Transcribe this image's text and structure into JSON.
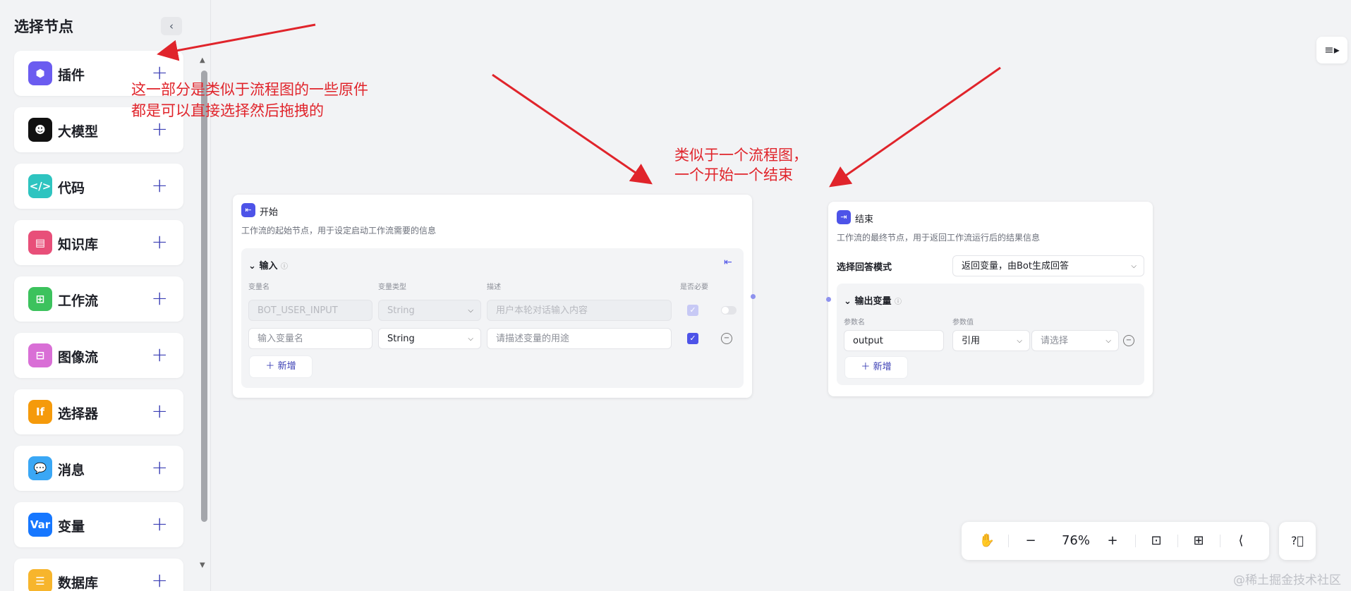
{
  "sidebar": {
    "title": "选择节点",
    "collapse_icon": "‹",
    "items": [
      {
        "label": "插件",
        "icon": "cube-icon",
        "icon_text": "⬢",
        "color": "#6b5cf0"
      },
      {
        "label": "大模型",
        "icon": "llm-face-icon",
        "icon_text": "☻",
        "color": "#111111"
      },
      {
        "label": "代码",
        "icon": "code-icon",
        "icon_text": "</>",
        "color": "#2ec4c0"
      },
      {
        "label": "知识库",
        "icon": "knowledge-icon",
        "icon_text": "▤",
        "color": "#e84f79"
      },
      {
        "label": "工作流",
        "icon": "workflow-icon",
        "icon_text": "⊞",
        "color": "#3cc25d"
      },
      {
        "label": "图像流",
        "icon": "imageflow-icon",
        "icon_text": "⊟",
        "color": "#d96fd6"
      },
      {
        "label": "选择器",
        "icon": "if-icon",
        "icon_text": "If",
        "color": "#f59a0b"
      },
      {
        "label": "消息",
        "icon": "message-icon",
        "icon_text": "💬",
        "color": "#3aa7f5"
      },
      {
        "label": "变量",
        "icon": "var-icon",
        "icon_text": "Var",
        "color": "#1677ff"
      },
      {
        "label": "数据库",
        "icon": "database-icon",
        "icon_text": "☰",
        "color": "#f7b52c"
      }
    ],
    "add_label": "+"
  },
  "start_node": {
    "title": "开始",
    "desc": "工作流的起始节点，用于设定启动工作流需要的信息",
    "section": "输入",
    "columns": [
      "变量名",
      "变量类型",
      "描述",
      "是否必要"
    ],
    "rows": [
      {
        "name": "BOT_USER_INPUT",
        "type": "String",
        "desc": "用户本轮对话输入内容",
        "required": true,
        "disabled": true
      },
      {
        "name_placeholder": "输入变量名",
        "type": "String",
        "desc_placeholder": "请描述变量的用途",
        "required": true,
        "disabled": false
      }
    ],
    "add_label": "新增"
  },
  "end_node": {
    "title": "结束",
    "desc": "工作流的最终节点，用于返回工作流运行后的结果信息",
    "mode_label": "选择回答模式",
    "mode_value": "返回变量，由Bot生成回答",
    "section": "输出变量",
    "columns": [
      "参数名",
      "参数值"
    ],
    "row": {
      "name": "output",
      "ref": "引用",
      "value_placeholder": "请选择"
    },
    "add_label": "新增"
  },
  "toolbar": {
    "zoom": "76%"
  },
  "annotations": {
    "a1_line1": "这一部分是类似于流程图的一些原件",
    "a1_line2": "都是可以直接选择然后拖拽的",
    "a2_line1": "类似于一个流程图，",
    "a2_line2": "一个开始一个结束"
  },
  "watermark": "@稀土掘金技术社区",
  "colors": {
    "accent": "#4d53e8",
    "annotation": "#e0242b"
  }
}
